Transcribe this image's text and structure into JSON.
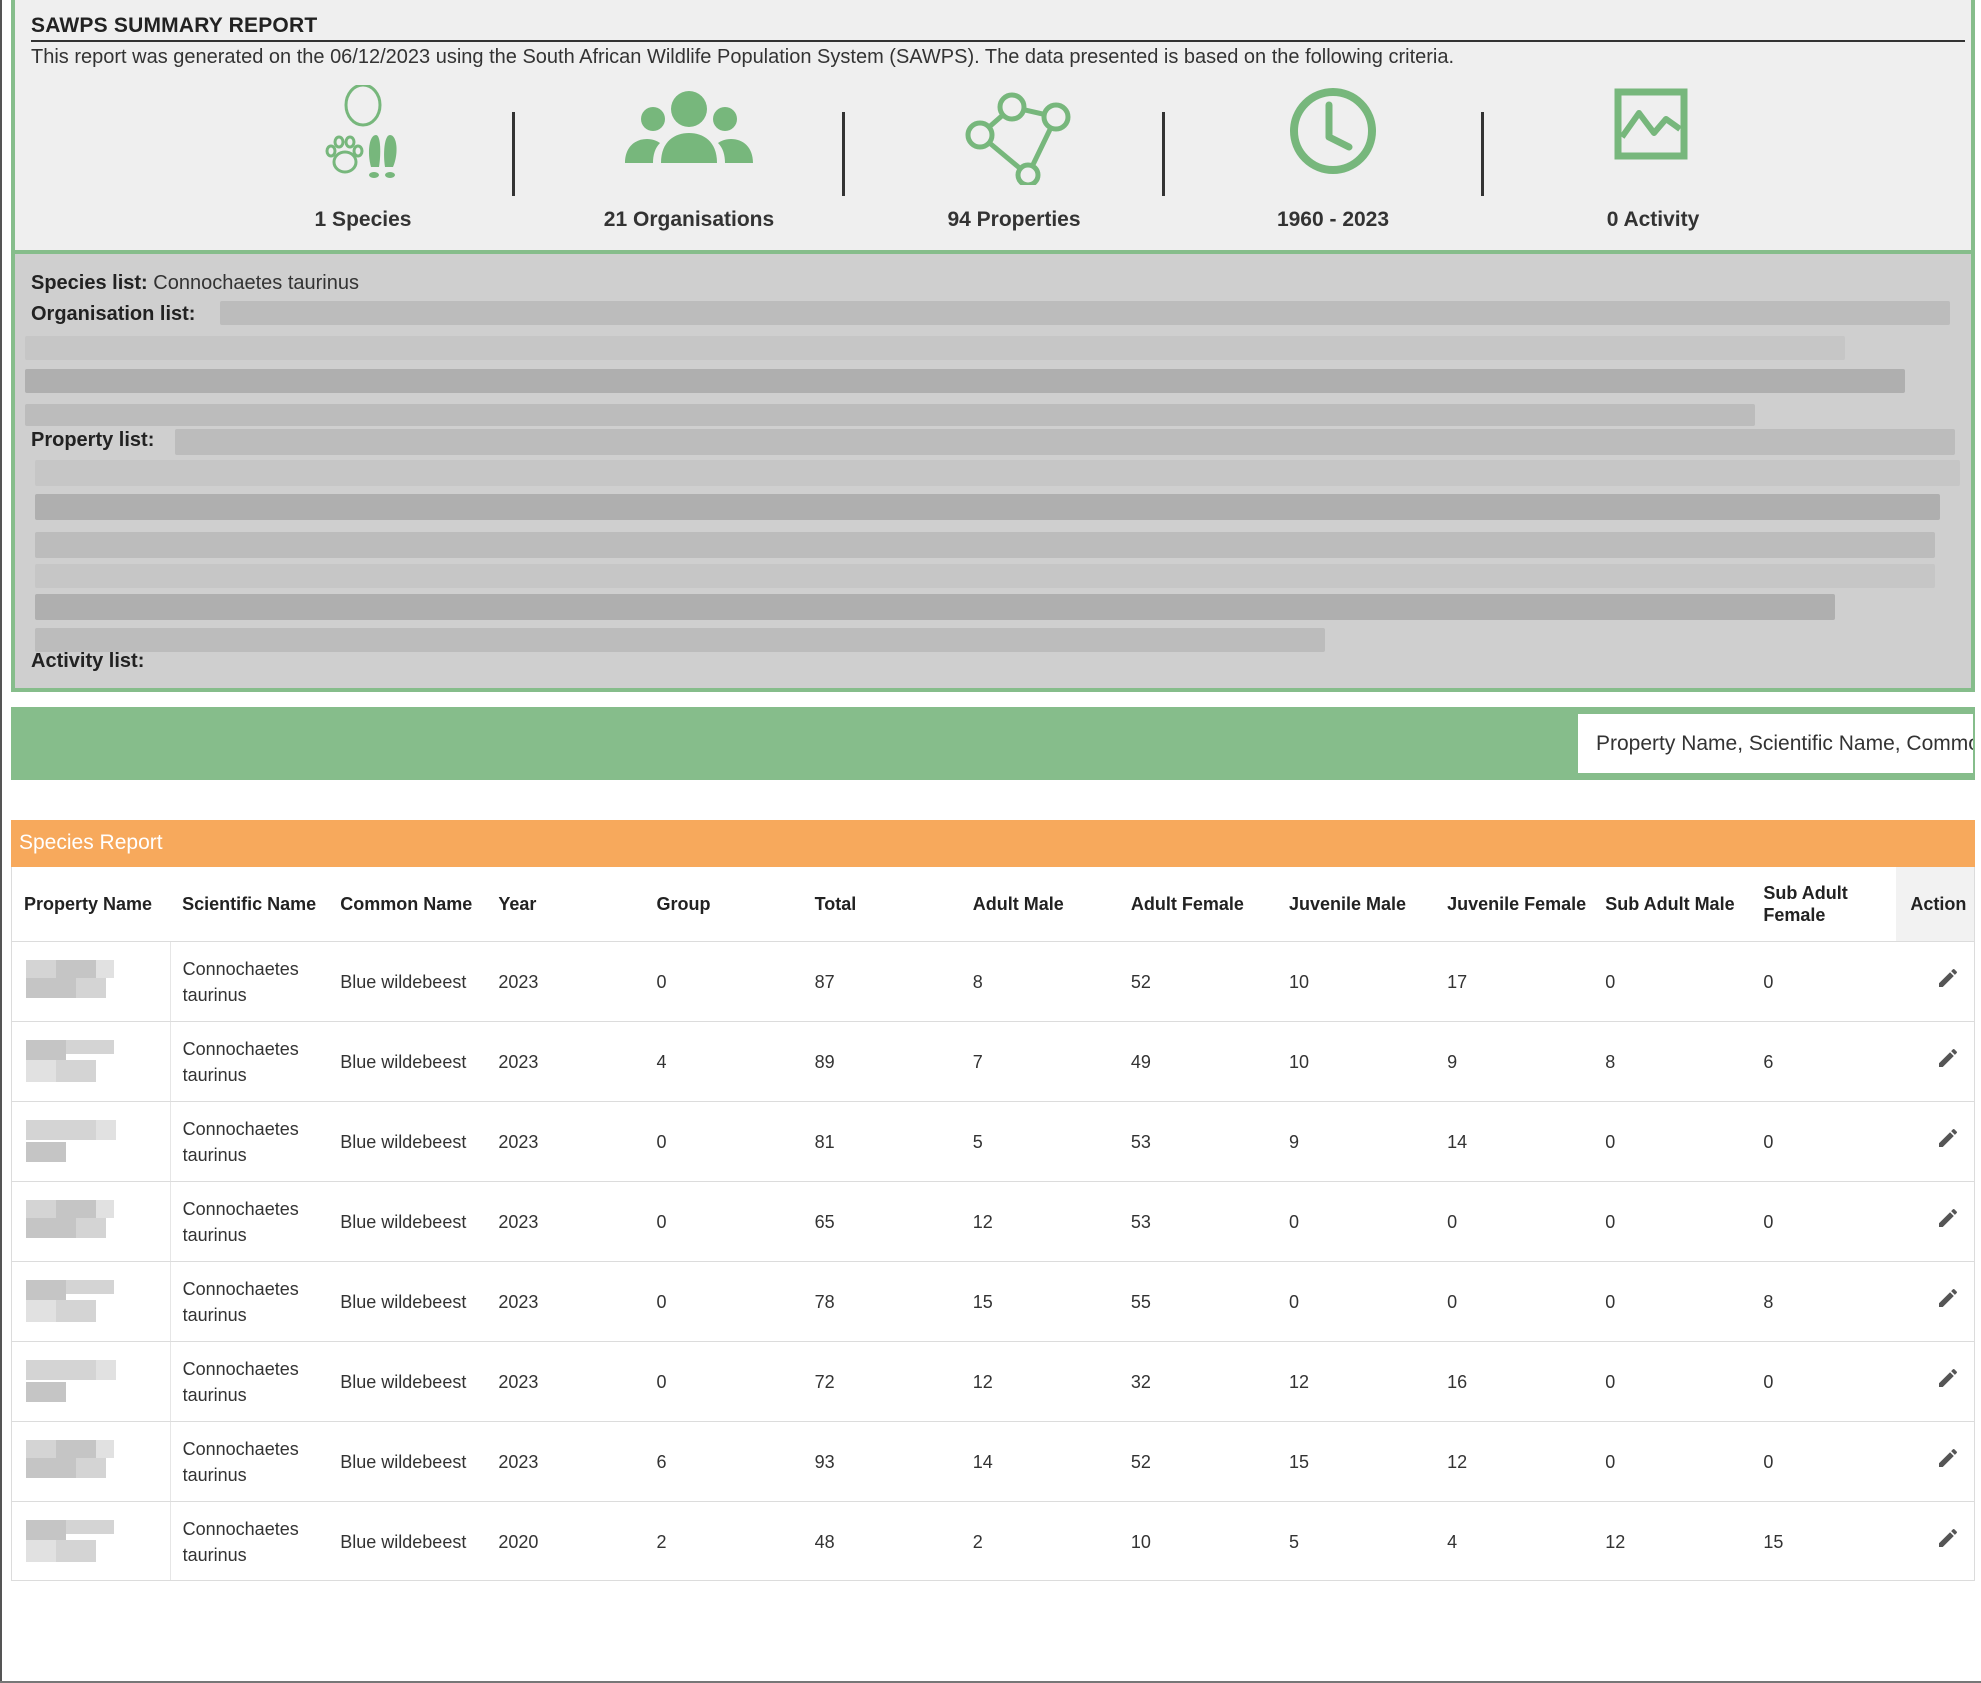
{
  "summary": {
    "title": "SAWPS SUMMARY REPORT",
    "description": "This report was generated on the 06/12/2023 using the South African Wildlife Population System (SAWPS). The data presented is based on the following criteria.",
    "stats": [
      {
        "icon": "species-paw-icon",
        "label": "1 Species"
      },
      {
        "icon": "organisations-users-icon",
        "label": "21 Organisations"
      },
      {
        "icon": "properties-polygon-icon",
        "label": "94 Properties"
      },
      {
        "icon": "clock-icon",
        "label": "1960 - 2023"
      },
      {
        "icon": "activity-chart-icon",
        "label": "0 Activity"
      }
    ],
    "species_list_label": "Species list:",
    "species_list_value": "Connochaetes taurinus",
    "organisation_list_label": "Organisation list:",
    "property_list_label": "Property list:",
    "activity_list_label": "Activity list:"
  },
  "search": {
    "placeholder": "Property Name, Scientific Name, Common Name"
  },
  "report": {
    "title": "Species Report",
    "columns": [
      "Property Name",
      "Scientific Name",
      "Common Name",
      "Year",
      "Group",
      "Total",
      "Adult Male",
      "Adult Female",
      "Juvenile Male",
      "Juvenile Female",
      "Sub Adult Male",
      "Sub Adult Female",
      "Action"
    ],
    "rows": [
      {
        "scientific": "Connochaetes taurinus",
        "common": "Blue wildebeest",
        "year": "2023",
        "group": "0",
        "total": "87",
        "adult_male": "8",
        "adult_female": "52",
        "juvenile_male": "10",
        "juvenile_female": "17",
        "sub_adult_male": "0",
        "sub_adult_female": "0"
      },
      {
        "scientific": "Connochaetes taurinus",
        "common": "Blue wildebeest",
        "year": "2023",
        "group": "4",
        "total": "89",
        "adult_male": "7",
        "adult_female": "49",
        "juvenile_male": "10",
        "juvenile_female": "9",
        "sub_adult_male": "8",
        "sub_adult_female": "6"
      },
      {
        "scientific": "Connochaetes taurinus",
        "common": "Blue wildebeest",
        "year": "2023",
        "group": "0",
        "total": "81",
        "adult_male": "5",
        "adult_female": "53",
        "juvenile_male": "9",
        "juvenile_female": "14",
        "sub_adult_male": "0",
        "sub_adult_female": "0"
      },
      {
        "scientific": "Connochaetes taurinus",
        "common": "Blue wildebeest",
        "year": "2023",
        "group": "0",
        "total": "65",
        "adult_male": "12",
        "adult_female": "53",
        "juvenile_male": "0",
        "juvenile_female": "0",
        "sub_adult_male": "0",
        "sub_adult_female": "0"
      },
      {
        "scientific": "Connochaetes taurinus",
        "common": "Blue wildebeest",
        "year": "2023",
        "group": "0",
        "total": "78",
        "adult_male": "15",
        "adult_female": "55",
        "juvenile_male": "0",
        "juvenile_female": "0",
        "sub_adult_male": "0",
        "sub_adult_female": "8"
      },
      {
        "scientific": "Connochaetes taurinus",
        "common": "Blue wildebeest",
        "year": "2023",
        "group": "0",
        "total": "72",
        "adult_male": "12",
        "adult_female": "32",
        "juvenile_male": "12",
        "juvenile_female": "16",
        "sub_adult_male": "0",
        "sub_adult_female": "0"
      },
      {
        "scientific": "Connochaetes taurinus",
        "common": "Blue wildebeest",
        "year": "2023",
        "group": "6",
        "total": "93",
        "adult_male": "14",
        "adult_female": "52",
        "juvenile_male": "15",
        "juvenile_female": "12",
        "sub_adult_male": "0",
        "sub_adult_female": "0"
      },
      {
        "scientific": "Connochaetes taurinus",
        "common": "Blue wildebeest",
        "year": "2020",
        "group": "2",
        "total": "48",
        "adult_male": "2",
        "adult_female": "10",
        "juvenile_male": "5",
        "juvenile_female": "4",
        "sub_adult_male": "12",
        "sub_adult_female": "15"
      }
    ]
  },
  "colors": {
    "accent_green": "#86bd8b",
    "icon_green": "#77b77c",
    "report_orange": "#f7a95c"
  }
}
